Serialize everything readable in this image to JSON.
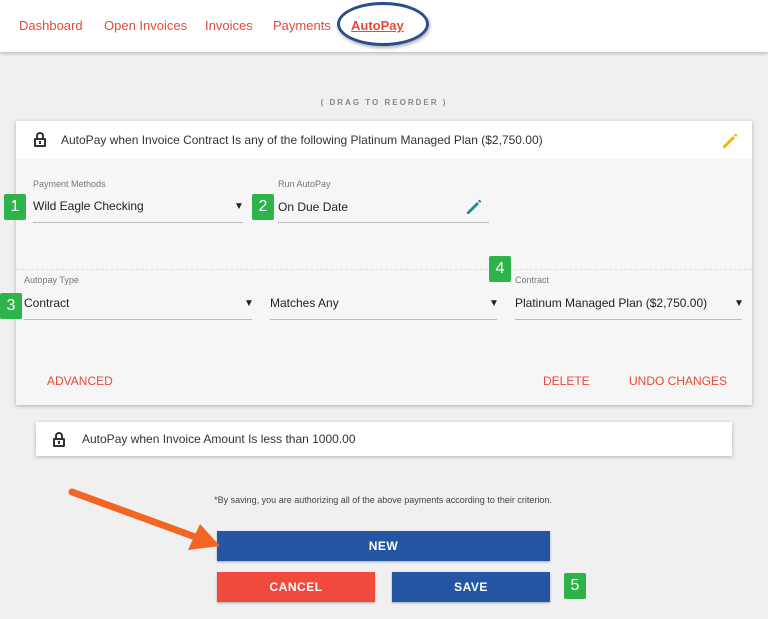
{
  "nav": {
    "items": [
      {
        "label": "Dashboard"
      },
      {
        "label": "Open Invoices"
      },
      {
        "label": "Invoices"
      },
      {
        "label": "Payments"
      },
      {
        "label": "AutoPay",
        "active": true
      }
    ]
  },
  "drag_hint": "( DRAG TO REORDER )",
  "rule1": {
    "title": "AutoPay when Invoice Contract Is any of the following Platinum Managed Plan ($2,750.00)",
    "payment_methods": {
      "label": "Payment Methods",
      "value": "Wild Eagle Checking"
    },
    "run_autopay": {
      "label": "Run AutoPay",
      "value": "On Due Date"
    },
    "autopay_type": {
      "label": "Autopay Type",
      "value": "Contract"
    },
    "match_mode": {
      "value": "Matches Any"
    },
    "contract": {
      "label": "Contract",
      "value": "Platinum Managed Plan ($2,750.00)"
    },
    "advanced_label": "ADVANCED",
    "delete_label": "DELETE",
    "undo_label": "UNDO CHANGES"
  },
  "rule2": {
    "title": "AutoPay when Invoice Amount Is less than 1000.00"
  },
  "disclaimer": "*By saving, you are authorizing all of the above payments according to their criterion.",
  "buttons": {
    "new_label": "NEW",
    "cancel_label": "CANCEL",
    "save_label": "SAVE"
  },
  "badges": [
    "1",
    "2",
    "3",
    "4",
    "5"
  ],
  "colors": {
    "accent_red": "#e8483a",
    "primary_blue": "#2456a4",
    "badge_green": "#2db34a",
    "arrow_orange": "#f26522",
    "pencil_yellow": "#f5b400",
    "pencil_teal": "#1b8f87"
  },
  "icons": [
    "lock-icon",
    "pencil-icon",
    "caret-down-icon",
    "arrow-annotation"
  ]
}
